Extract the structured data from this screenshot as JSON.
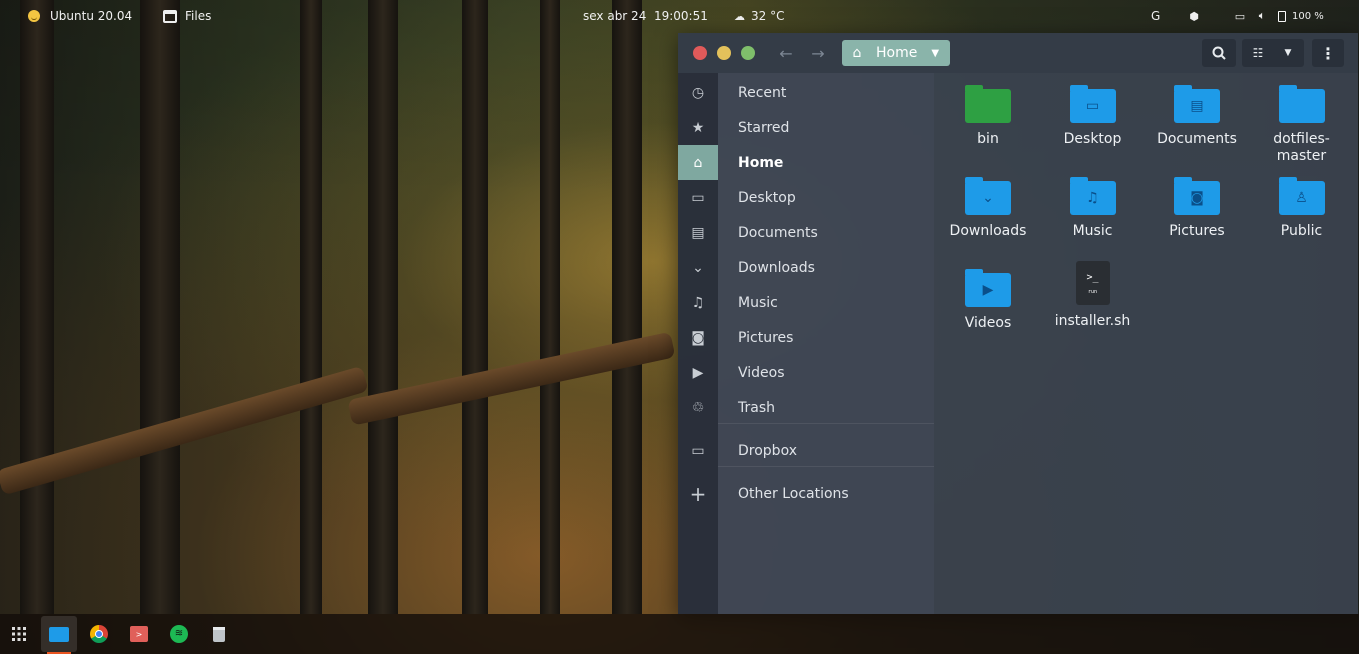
{
  "topbar": {
    "os_label": "Ubuntu 20.04",
    "app_label": "Files",
    "clock": "sex abr 24  19:00:51",
    "weather": "32 °C",
    "tray_g": "G",
    "battery": "100 %",
    "icons": [
      "smiley-icon",
      "files-app-icon",
      "weather-icon",
      "shield-icon",
      "screen-icon",
      "volume-icon",
      "battery-icon"
    ]
  },
  "window": {
    "path_label": "Home",
    "colors": {
      "close": "#e05a5a",
      "minimize": "#e3c15b",
      "maximize": "#7fbf6b",
      "accent": "#8ab4aa"
    }
  },
  "sidebar": {
    "items": [
      {
        "label": "Recent",
        "icon": "clock-icon"
      },
      {
        "label": "Starred",
        "icon": "star-icon"
      },
      {
        "label": "Home",
        "icon": "home-icon",
        "active": true
      },
      {
        "label": "Desktop",
        "icon": "desktop-icon"
      },
      {
        "label": "Documents",
        "icon": "document-icon"
      },
      {
        "label": "Downloads",
        "icon": "download-icon"
      },
      {
        "label": "Music",
        "icon": "music-icon"
      },
      {
        "label": "Pictures",
        "icon": "camera-icon"
      },
      {
        "label": "Videos",
        "icon": "video-icon"
      },
      {
        "label": "Trash",
        "icon": "trash-icon"
      },
      {
        "label": "Dropbox",
        "icon": "folder-icon"
      },
      {
        "label": "Other Locations",
        "icon": "plus-icon"
      }
    ]
  },
  "files": [
    {
      "name": "bin",
      "kind": "folder",
      "color": "#2ea043"
    },
    {
      "name": "Desktop",
      "kind": "folder",
      "color": "#1e9be8"
    },
    {
      "name": "Documents",
      "kind": "folder",
      "color": "#1e9be8"
    },
    {
      "name": "dotfiles-\nmaster",
      "kind": "folder",
      "color": "#1e9be8"
    },
    {
      "name": "Downloads",
      "kind": "folder",
      "color": "#1e9be8"
    },
    {
      "name": "Music",
      "kind": "folder",
      "color": "#1e9be8"
    },
    {
      "name": "Pictures",
      "kind": "folder",
      "color": "#1e9be8"
    },
    {
      "name": "Public",
      "kind": "folder",
      "color": "#1e9be8"
    },
    {
      "name": "Videos",
      "kind": "folder",
      "color": "#1e9be8"
    },
    {
      "name": "installer.sh",
      "kind": "script",
      "glyph": ">_",
      "sub": "run"
    }
  ],
  "dock": {
    "apps": [
      "apps-grid-icon",
      "files-icon",
      "chrome-icon",
      "terminal-icon",
      "spotify-icon",
      "trash-icon"
    ]
  }
}
